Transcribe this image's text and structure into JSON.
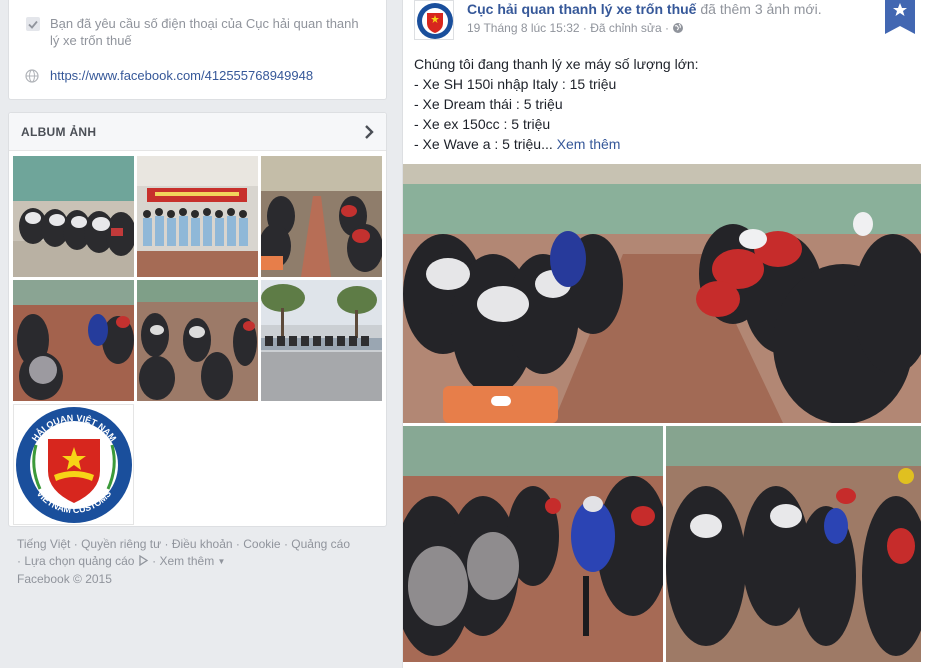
{
  "about": {
    "request_text": "Bạn đã yêu cầu số điện thoại của Cục hải quan thanh lý xe trốn thuế",
    "link": "https://www.facebook.com/412555768949948"
  },
  "album": {
    "title": "ALBUM ẢNH"
  },
  "logo": {
    "top_text": "HẢI QUAN VIỆT NAM",
    "bottom_text": "VIETNAM CUSTOMS"
  },
  "footer": {
    "links": [
      "Tiếng Việt",
      "Quyền riêng tư",
      "Điều khoản",
      "Cookie",
      "Quảng cáo"
    ],
    "ad_choices": "Lựa chọn quảng cáo",
    "more": "Xem thêm",
    "copyright": "Facebook © 2015"
  },
  "post": {
    "page_name": "Cục hải quan thanh lý xe trốn thuế",
    "added_text": "đã thêm 3 ảnh mới.",
    "timestamp": "19 Tháng 8 lúc 15:32",
    "edited": "Đã chỉnh sửa",
    "lines": [
      "Chúng tôi đang thanh lý xe máy số lượng lớn:",
      "- Xe SH 150i nhập Italy : 15 triệu",
      "- Xe Dream thái : 5 triệu",
      "- Xe ex 150cc : 5 triệu",
      "- Xe Wave a : 5 triệu..."
    ],
    "see_more": "Xem thêm"
  },
  "colors": {
    "link": "#365899",
    "muted": "#90949c",
    "bookmark": "#4267b2"
  }
}
